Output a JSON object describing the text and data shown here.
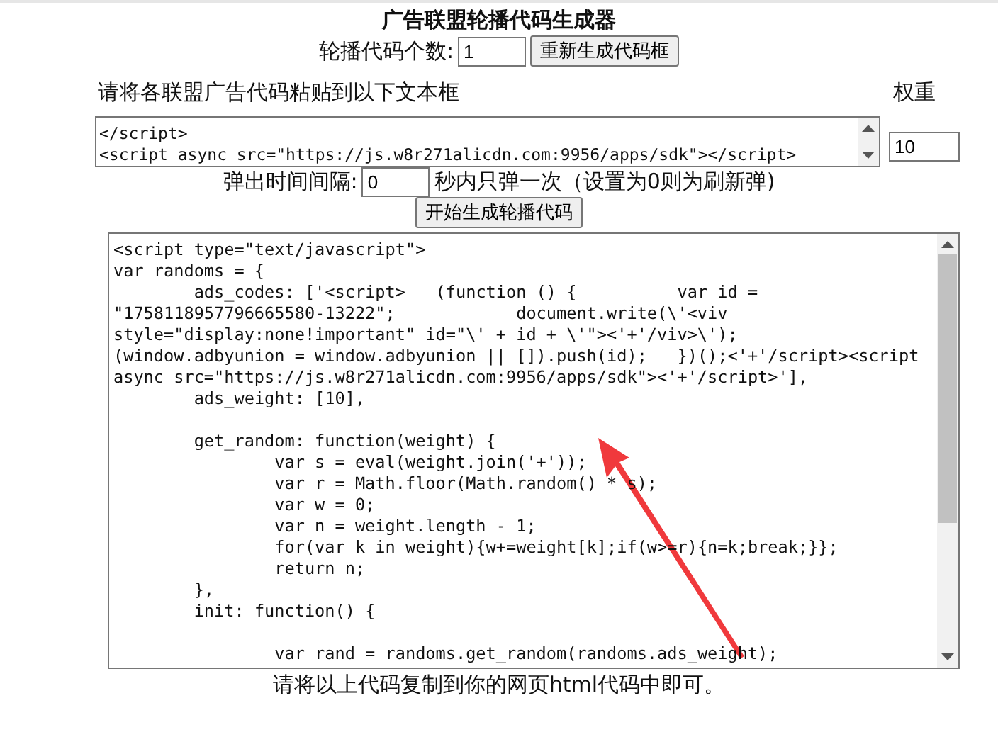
{
  "title": "广告联盟轮播代码生成器",
  "count_row": {
    "label": "轮播代码个数:",
    "value": "1",
    "button": "重新生成代码框"
  },
  "paste_label": "请将各联盟广告代码粘贴到以下文本框",
  "weight_label": "权重",
  "ad_codes": [
    {
      "value": "</script>\n<script async src=\"https://js.w8r271alicdn.com:9956/apps/sdk\"></script>",
      "weight": "10"
    }
  ],
  "interval_row": {
    "label": "弹出时间间隔:",
    "value": "0",
    "suffix": "秒内只弹一次（设置为0则为刷新弹)"
  },
  "generate_button": "开始生成轮播代码",
  "output_code": "<script type=\"text/javascript\">\nvar randoms = {\n\tads_codes: ['<script>\t(function () {\t\tvar id =\n\"1758118957796665580-13222\";\t\tdocument.write(\\'<viv\nstyle=\"display:none!important\" id=\"\\' + id + \\'\"><'+'/viv>\\');\n(window.adbyunion = window.adbyunion || []).push(id);\t})();<'+'/script><script\nasync src=\"https://js.w8r271alicdn.com:9956/apps/sdk\"><'+'/script>'],\n\tads_weight: [10],\n\n\tget_random: function(weight) {\n\t\tvar s = eval(weight.join('+'));\n\t\tvar r = Math.floor(Math.random() * s);\n\t\tvar w = 0;\n\t\tvar n = weight.length - 1;\n\t\tfor(var k in weight){w+=weight[k];if(w>=r){n=k;break;}};\n\t\treturn n;\n\t},\n\tinit: function() {\n\n\t\tvar rand = randoms.get_random(randoms.ads_weight);",
  "footer": "请将以上代码复制到你的网页html代码中即可。"
}
